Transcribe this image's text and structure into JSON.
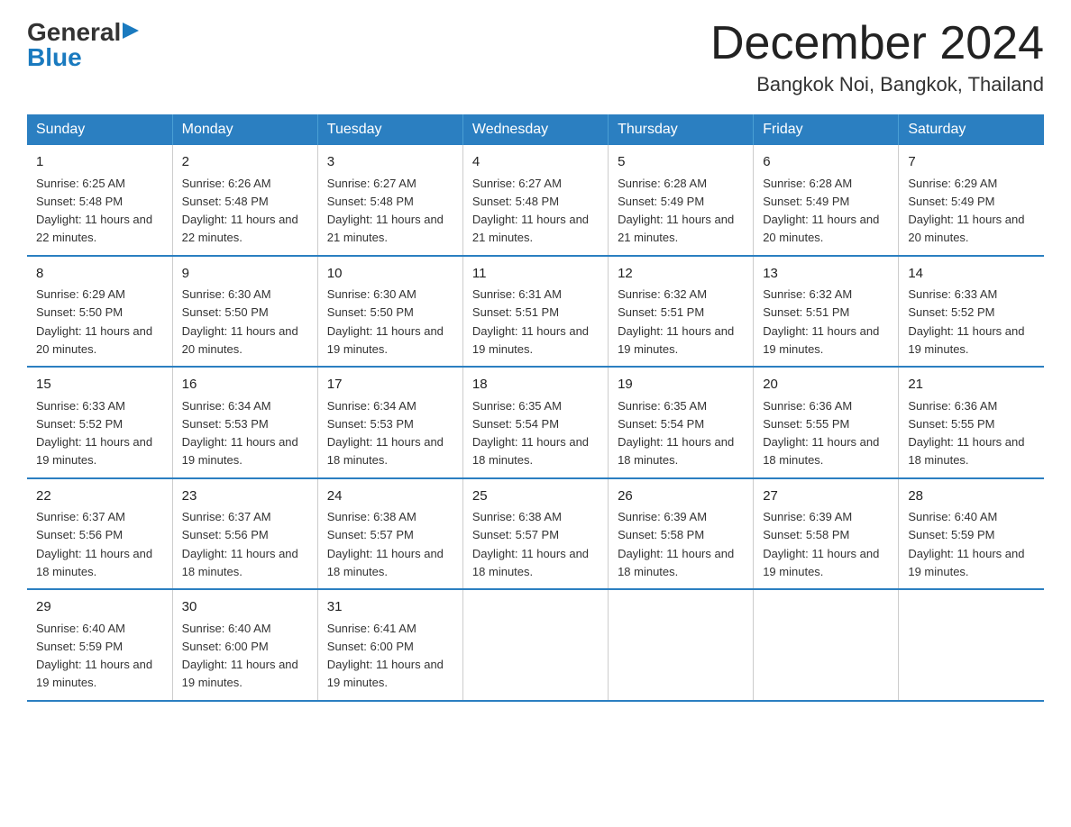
{
  "header": {
    "logo": {
      "general": "General",
      "blue": "Blue",
      "alt": "GeneralBlue logo"
    },
    "title": "December 2024",
    "location": "Bangkok Noi, Bangkok, Thailand"
  },
  "calendar": {
    "days_of_week": [
      "Sunday",
      "Monday",
      "Tuesday",
      "Wednesday",
      "Thursday",
      "Friday",
      "Saturday"
    ],
    "weeks": [
      [
        {
          "day": "1",
          "sunrise": "6:25 AM",
          "sunset": "5:48 PM",
          "daylight": "11 hours and 22 minutes."
        },
        {
          "day": "2",
          "sunrise": "6:26 AM",
          "sunset": "5:48 PM",
          "daylight": "11 hours and 22 minutes."
        },
        {
          "day": "3",
          "sunrise": "6:27 AM",
          "sunset": "5:48 PM",
          "daylight": "11 hours and 21 minutes."
        },
        {
          "day": "4",
          "sunrise": "6:27 AM",
          "sunset": "5:48 PM",
          "daylight": "11 hours and 21 minutes."
        },
        {
          "day": "5",
          "sunrise": "6:28 AM",
          "sunset": "5:49 PM",
          "daylight": "11 hours and 21 minutes."
        },
        {
          "day": "6",
          "sunrise": "6:28 AM",
          "sunset": "5:49 PM",
          "daylight": "11 hours and 20 minutes."
        },
        {
          "day": "7",
          "sunrise": "6:29 AM",
          "sunset": "5:49 PM",
          "daylight": "11 hours and 20 minutes."
        }
      ],
      [
        {
          "day": "8",
          "sunrise": "6:29 AM",
          "sunset": "5:50 PM",
          "daylight": "11 hours and 20 minutes."
        },
        {
          "day": "9",
          "sunrise": "6:30 AM",
          "sunset": "5:50 PM",
          "daylight": "11 hours and 20 minutes."
        },
        {
          "day": "10",
          "sunrise": "6:30 AM",
          "sunset": "5:50 PM",
          "daylight": "11 hours and 19 minutes."
        },
        {
          "day": "11",
          "sunrise": "6:31 AM",
          "sunset": "5:51 PM",
          "daylight": "11 hours and 19 minutes."
        },
        {
          "day": "12",
          "sunrise": "6:32 AM",
          "sunset": "5:51 PM",
          "daylight": "11 hours and 19 minutes."
        },
        {
          "day": "13",
          "sunrise": "6:32 AM",
          "sunset": "5:51 PM",
          "daylight": "11 hours and 19 minutes."
        },
        {
          "day": "14",
          "sunrise": "6:33 AM",
          "sunset": "5:52 PM",
          "daylight": "11 hours and 19 minutes."
        }
      ],
      [
        {
          "day": "15",
          "sunrise": "6:33 AM",
          "sunset": "5:52 PM",
          "daylight": "11 hours and 19 minutes."
        },
        {
          "day": "16",
          "sunrise": "6:34 AM",
          "sunset": "5:53 PM",
          "daylight": "11 hours and 19 minutes."
        },
        {
          "day": "17",
          "sunrise": "6:34 AM",
          "sunset": "5:53 PM",
          "daylight": "11 hours and 18 minutes."
        },
        {
          "day": "18",
          "sunrise": "6:35 AM",
          "sunset": "5:54 PM",
          "daylight": "11 hours and 18 minutes."
        },
        {
          "day": "19",
          "sunrise": "6:35 AM",
          "sunset": "5:54 PM",
          "daylight": "11 hours and 18 minutes."
        },
        {
          "day": "20",
          "sunrise": "6:36 AM",
          "sunset": "5:55 PM",
          "daylight": "11 hours and 18 minutes."
        },
        {
          "day": "21",
          "sunrise": "6:36 AM",
          "sunset": "5:55 PM",
          "daylight": "11 hours and 18 minutes."
        }
      ],
      [
        {
          "day": "22",
          "sunrise": "6:37 AM",
          "sunset": "5:56 PM",
          "daylight": "11 hours and 18 minutes."
        },
        {
          "day": "23",
          "sunrise": "6:37 AM",
          "sunset": "5:56 PM",
          "daylight": "11 hours and 18 minutes."
        },
        {
          "day": "24",
          "sunrise": "6:38 AM",
          "sunset": "5:57 PM",
          "daylight": "11 hours and 18 minutes."
        },
        {
          "day": "25",
          "sunrise": "6:38 AM",
          "sunset": "5:57 PM",
          "daylight": "11 hours and 18 minutes."
        },
        {
          "day": "26",
          "sunrise": "6:39 AM",
          "sunset": "5:58 PM",
          "daylight": "11 hours and 18 minutes."
        },
        {
          "day": "27",
          "sunrise": "6:39 AM",
          "sunset": "5:58 PM",
          "daylight": "11 hours and 19 minutes."
        },
        {
          "day": "28",
          "sunrise": "6:40 AM",
          "sunset": "5:59 PM",
          "daylight": "11 hours and 19 minutes."
        }
      ],
      [
        {
          "day": "29",
          "sunrise": "6:40 AM",
          "sunset": "5:59 PM",
          "daylight": "11 hours and 19 minutes."
        },
        {
          "day": "30",
          "sunrise": "6:40 AM",
          "sunset": "6:00 PM",
          "daylight": "11 hours and 19 minutes."
        },
        {
          "day": "31",
          "sunrise": "6:41 AM",
          "sunset": "6:00 PM",
          "daylight": "11 hours and 19 minutes."
        },
        null,
        null,
        null,
        null
      ]
    ]
  }
}
